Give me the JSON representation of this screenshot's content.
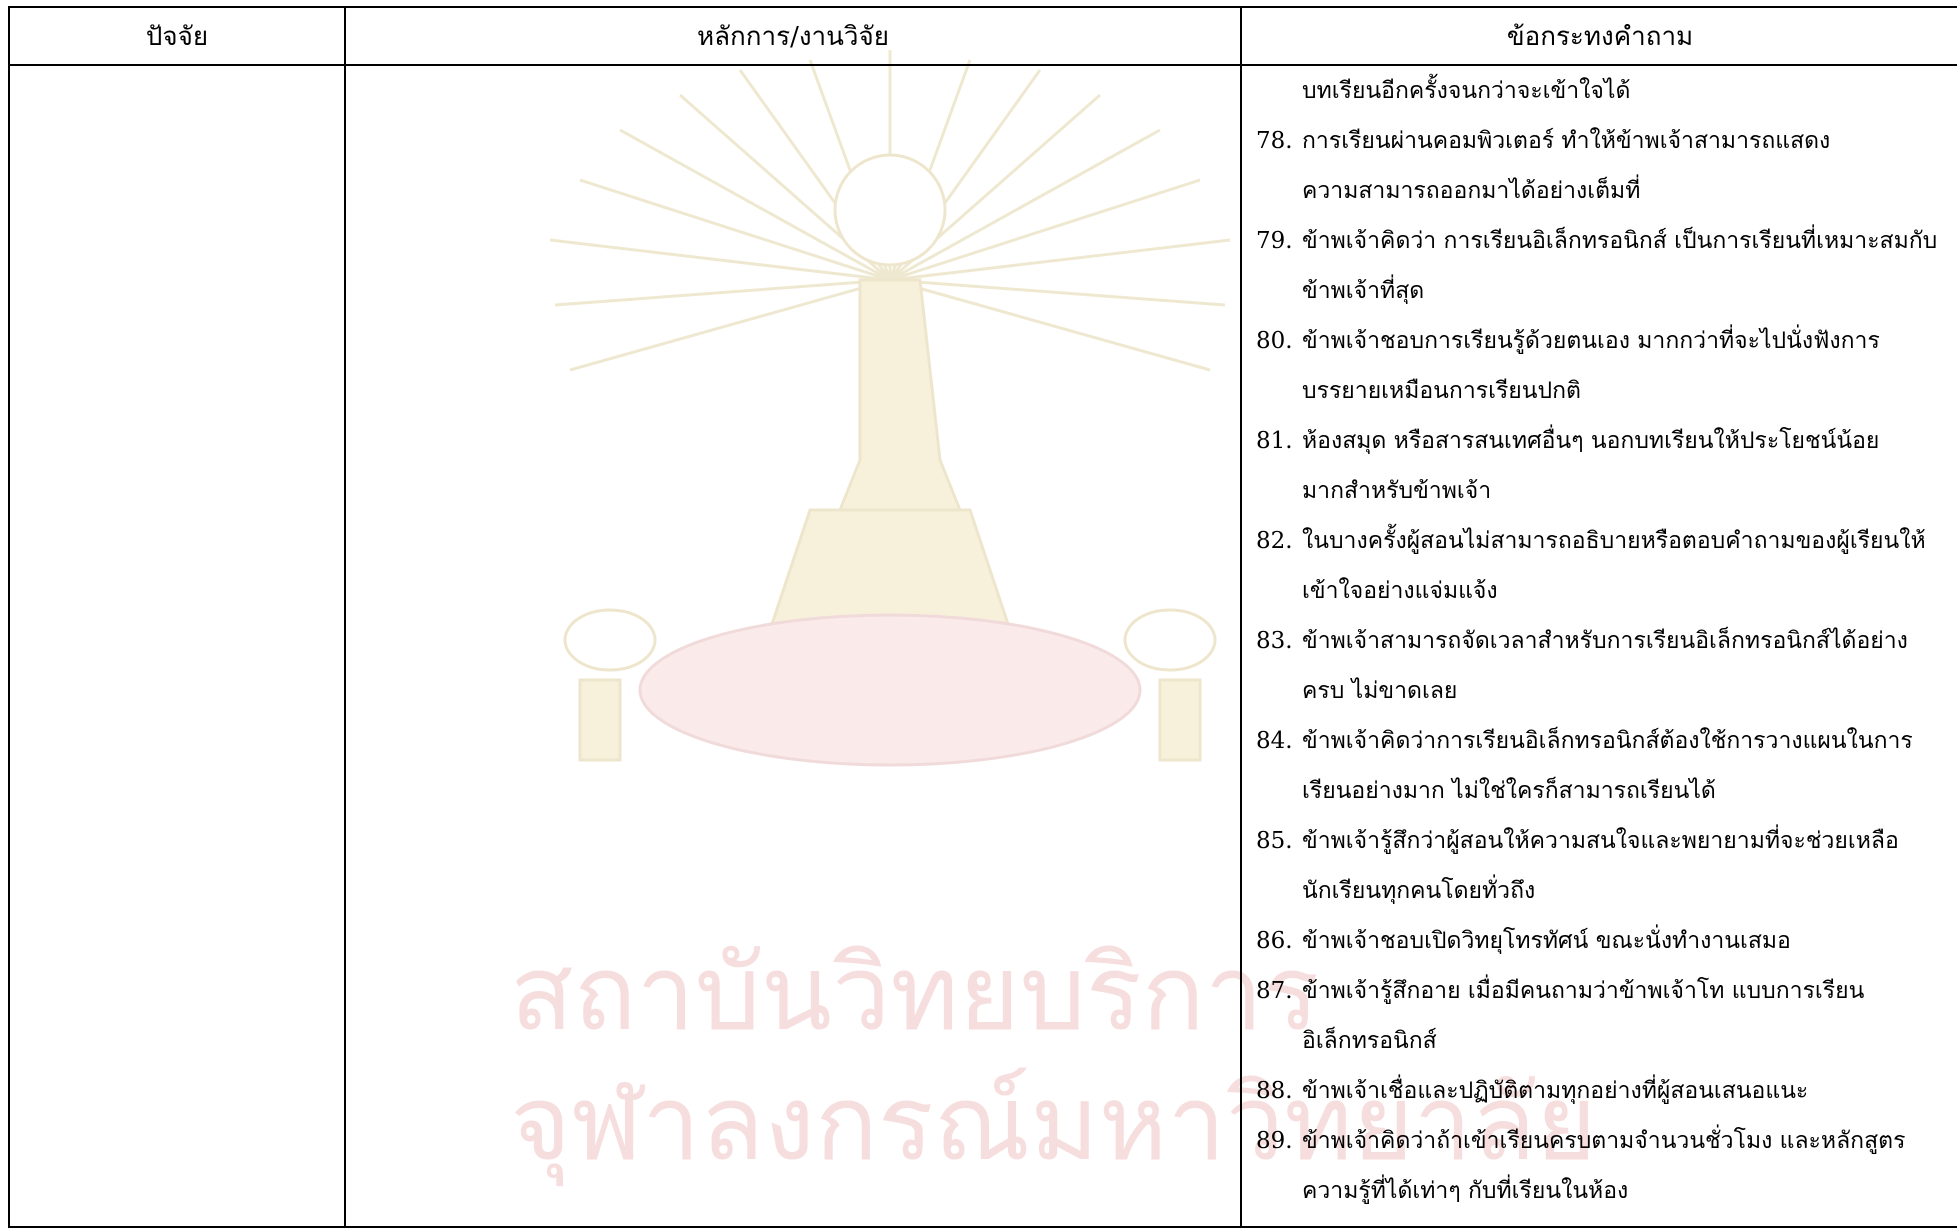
{
  "table": {
    "headers": [
      "ปัจจัย",
      "หลักการ/งานวิจัย",
      "ข้อกระทงคำถาม"
    ],
    "questions": [
      {
        "num": "",
        "text": "บทเรียนอีกครั้งจนกว่าจะเข้าใจได้"
      },
      {
        "num": "78.",
        "text": "การเรียนผ่านคอมพิวเตอร์ ทำให้ข้าพเจ้าสามารถแสดง"
      },
      {
        "num": "",
        "text": "ความสามารถออกมาได้อย่างเต็มที่"
      },
      {
        "num": "79.",
        "text": "ข้าพเจ้าคิดว่า การเรียนอิเล็กทรอนิกส์ เป็นการเรียนที่เหมาะสมกับ"
      },
      {
        "num": "",
        "text": "ข้าพเจ้าที่สุด"
      },
      {
        "num": "80.",
        "text": "ข้าพเจ้าชอบการเรียนรู้ด้วยตนเอง มากกว่าที่จะไปนั่งฟังการ"
      },
      {
        "num": "",
        "text": "บรรยายเหมือนการเรียนปกติ"
      },
      {
        "num": "81.",
        "text": "ห้องสมุด หรือสารสนเทศอื่นๆ นอกบทเรียนให้ประโยชน์น้อย"
      },
      {
        "num": "",
        "text": "มากสำหรับข้าพเจ้า"
      },
      {
        "num": "82.",
        "text": "ในบางครั้งผู้สอนไม่สามารถอธิบายหรือตอบคำถามของผู้เรียนให้"
      },
      {
        "num": "",
        "text": "เข้าใจอย่างแจ่มแจ้ง"
      },
      {
        "num": "83.",
        "text": "ข้าพเจ้าสามารถจัดเวลาสำหรับการเรียนอิเล็กทรอนิกส์ได้อย่าง"
      },
      {
        "num": "",
        "text": "ครบ ไม่ขาดเลย"
      },
      {
        "num": "84.",
        "text": "ข้าพเจ้าคิดว่าการเรียนอิเล็กทรอนิกส์ต้องใช้การวางแผนในการ"
      },
      {
        "num": "",
        "text": "เรียนอย่างมาก ไม่ใช่ใครก็สามารถเรียนได้"
      },
      {
        "num": "85.",
        "text": "ข้าพเจ้ารู้สึกว่าผู้สอนให้ความสนใจและพยายามที่จะช่วยเหลือ"
      },
      {
        "num": "",
        "text": "นักเรียนทุกคนโดยทั่วถึง"
      },
      {
        "num": "86.",
        "text": "ข้าพเจ้าชอบเปิดวิทยุโทรทัศน์ ขณะนั่งทำงานเสมอ"
      },
      {
        "num": "87.",
        "text": "ข้าพเจ้ารู้สึกอาย เมื่อมีคนถามว่าข้าพเจ้าโท แบบการเรียน"
      },
      {
        "num": "",
        "text": "อิเล็กทรอนิกส์"
      },
      {
        "num": "88.",
        "text": "ข้าพเจ้าเชื่อและปฏิบัติตามทุกอย่างที่ผู้สอนเสนอแนะ"
      },
      {
        "num": "89.",
        "text": "ข้าพเจ้าคิดว่าถ้าเข้าเรียนครบตามจำนวนชั่วโมง และหลักสูตร"
      },
      {
        "num": "",
        "text": "ความรู้ที่ได้เท่าๆ กับที่เรียนในห้อง"
      }
    ]
  },
  "watermark": {
    "line1": "สถาบันวิทยบริการ",
    "line2": "จุฬาลงกรณ์มหาวิทยาลัย",
    "color": "#f7dede"
  }
}
